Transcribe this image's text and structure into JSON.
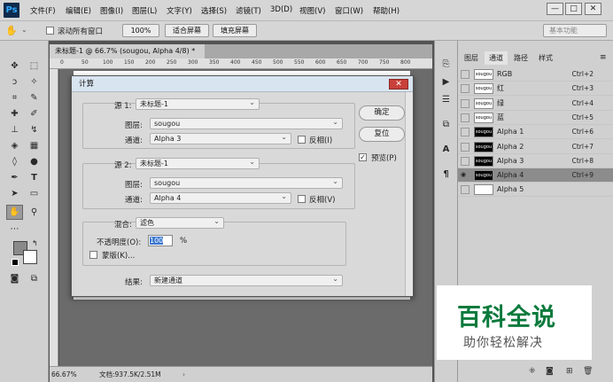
{
  "app": {
    "logo": "Ps"
  },
  "menu": [
    "文件(F)",
    "编辑(E)",
    "图像(I)",
    "图层(L)",
    "文字(Y)",
    "选择(S)",
    "滤镜(T)",
    "3D(D)",
    "视图(V)",
    "窗口(W)",
    "帮助(H)"
  ],
  "window_controls": {
    "minimize": "—",
    "restore": "□",
    "close": "✕"
  },
  "options": {
    "scroll_all": "滚动所有窗口",
    "zoom": "100%",
    "fit_screen": "适合屏幕",
    "fill_screen": "填充屏幕",
    "workspace": "基本功能"
  },
  "document": {
    "tab_title": "未标题-1 @ 66.7% (sougou, Alpha 4/8) *",
    "tab_close": "×"
  },
  "ruler": {
    "marks": [
      "0",
      "50",
      "100",
      "150",
      "200",
      "250",
      "300",
      "350",
      "400",
      "450",
      "500",
      "550",
      "600",
      "650",
      "700",
      "750",
      "800"
    ]
  },
  "status": {
    "zoom": "66.67%",
    "doc": "文档:937.5K/2.51M"
  },
  "panels": {
    "tabs": [
      "图层",
      "通道",
      "路径",
      "样式"
    ],
    "active_tab": "通道"
  },
  "channels": [
    {
      "name": "RGB",
      "key": "Ctrl+2",
      "thumb": "sougou",
      "visible": false
    },
    {
      "name": "红",
      "key": "Ctrl+3",
      "thumb": "sougou",
      "visible": false
    },
    {
      "name": "绿",
      "key": "Ctrl+4",
      "thumb": "sougou",
      "visible": false
    },
    {
      "name": "蓝",
      "key": "Ctrl+5",
      "thumb": "sougou",
      "visible": false
    },
    {
      "name": "Alpha 1",
      "key": "Ctrl+6",
      "thumb": "sougou",
      "visible": false
    },
    {
      "name": "Alpha 2",
      "key": "Ctrl+7",
      "thumb": "sougou",
      "visible": false
    },
    {
      "name": "Alpha 3",
      "key": "Ctrl+8",
      "thumb": "sougou",
      "visible": false
    },
    {
      "name": "Alpha 4",
      "key": "Ctrl+9",
      "thumb": "sougou",
      "visible": true,
      "selected": true
    },
    {
      "name": "Alpha 5",
      "key": "",
      "thumb": "",
      "visible": false
    }
  ],
  "dialog": {
    "title": "计算",
    "close": "✕",
    "source1": {
      "label": "源 1:",
      "value": "未标题-1",
      "layer_label": "图层:",
      "layer_value": "sougou",
      "channel_label": "通道:",
      "channel_value": "Alpha 3",
      "invert_label": "反相(I)"
    },
    "source2": {
      "label": "源 2:",
      "value": "未标题-1",
      "layer_label": "图层:",
      "layer_value": "sougou",
      "channel_label": "通道:",
      "channel_value": "Alpha 4",
      "invert_label": "反相(V)"
    },
    "blend": {
      "label": "混合:",
      "value": "滤色",
      "opacity_label": "不透明度(O):",
      "opacity_value": "100",
      "opacity_unit": "%",
      "mask_label": "蒙版(K)..."
    },
    "result": {
      "label": "结果:",
      "value": "新建通道"
    },
    "ok": "确定",
    "reset": "复位",
    "preview": "预览(P)"
  },
  "watermark": {
    "main": "百科全说",
    "sub": "助你轻松解决"
  },
  "colors": {
    "accent": "#0a7a3c",
    "dialog_bg": "#d9d9d9",
    "selected_row": "#8c8c8c"
  }
}
